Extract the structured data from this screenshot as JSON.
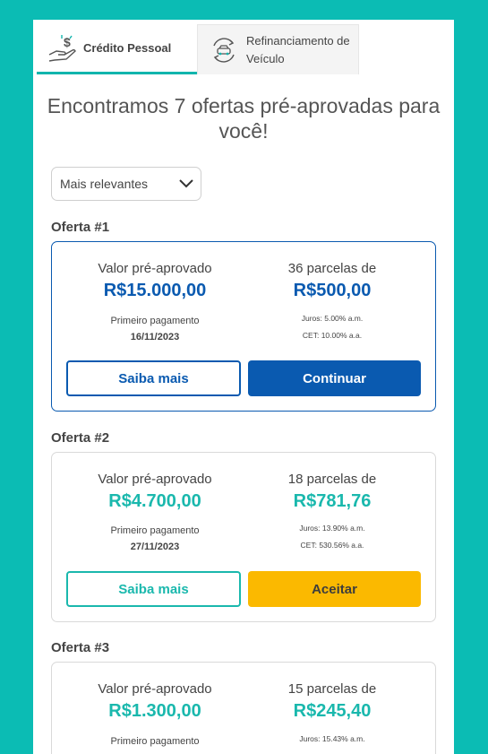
{
  "tabs": [
    {
      "label": "Crédito Pessoal",
      "icon": "hand-money-icon"
    },
    {
      "label": "Refinanciamento de Veículo",
      "icon": "car-refinance-icon"
    }
  ],
  "heading": "Encontramos 7 ofertas pré-aprovadas para você!",
  "sort": {
    "value": "Mais relevantes"
  },
  "offers": [
    {
      "label": "Oferta #1",
      "pre_label": "Valor pré-aprovado",
      "amount": "R$15.000,00",
      "installments_label": "36 parcelas de",
      "installment_value": "R$500,00",
      "first_payment_label": "Primeiro pagamento",
      "first_payment_date": "16/11/2023",
      "interest": "Juros: 5.00% a.m.",
      "cet": "CET: 10.00% a.a.",
      "secondary_button": "Saiba mais",
      "primary_button": "Continuar"
    },
    {
      "label": "Oferta #2",
      "pre_label": "Valor pré-aprovado",
      "amount": "R$4.700,00",
      "installments_label": "18 parcelas de",
      "installment_value": "R$781,76",
      "first_payment_label": "Primeiro pagamento",
      "first_payment_date": "27/11/2023",
      "interest": "Juros: 13.90% a.m.",
      "cet": "CET: 530.56% a.a.",
      "secondary_button": "Saiba mais",
      "primary_button": "Aceitar"
    },
    {
      "label": "Oferta #3",
      "pre_label": "Valor pré-aprovado",
      "amount": "R$1.300,00",
      "installments_label": "15 parcelas de",
      "installment_value": "R$245,40",
      "first_payment_label": "Primeiro pagamento",
      "interest": "Juros: 15.43% a.m."
    }
  ],
  "colors": {
    "background": "#0bbcb4",
    "primary_blue": "#0a5ab0",
    "teal": "#1ab8ad",
    "accept_yellow": "#fbb900"
  }
}
